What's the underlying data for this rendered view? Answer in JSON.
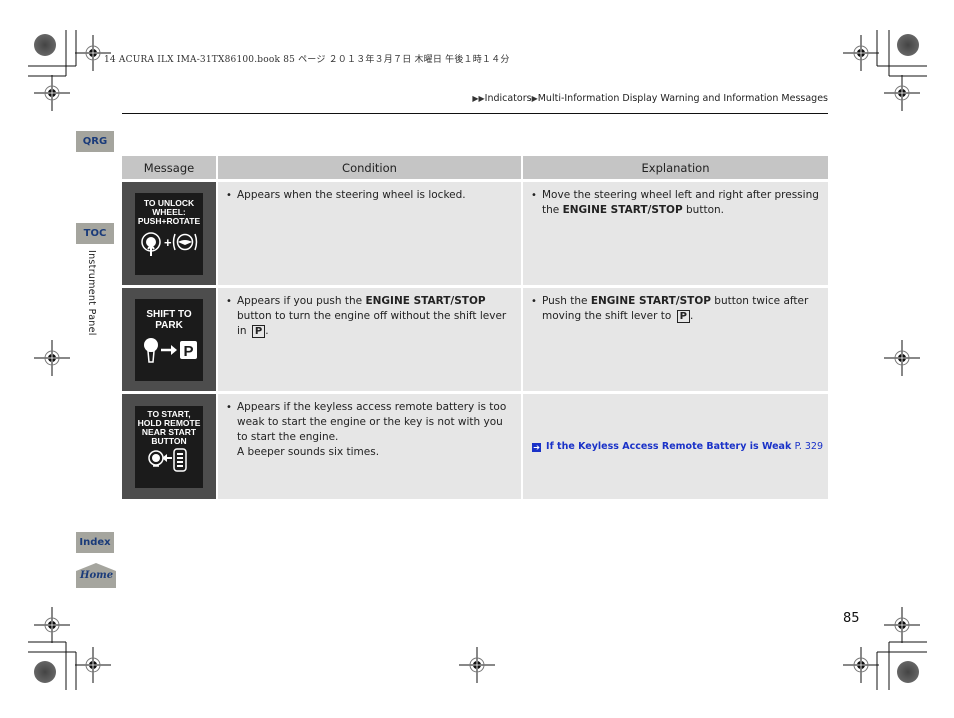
{
  "print_header": "14 ACURA ILX IMA-31TX86100.book  85 ページ  ２０１３年３月７日  木曜日  午後１時１４分",
  "breadcrumb": {
    "prefix_icon": "double-triangle-right-icon",
    "items": [
      "Indicators",
      "Multi-Information Display Warning and Information Messages"
    ],
    "separator_icon": "triangle-right-icon"
  },
  "nav": {
    "qrg": "QRG",
    "toc": "TOC",
    "section_label": "Instrument Panel",
    "index": "Index",
    "home": "Home"
  },
  "table": {
    "headers": [
      "Message",
      "Condition",
      "Explanation"
    ],
    "rows": [
      {
        "message_display": [
          "TO UNLOCK",
          "WHEEL:",
          "PUSH+ROTATE"
        ],
        "message_icon": "push-button-plus-steering-wheel-icon",
        "condition": {
          "text": "Appears when the steering wheel is locked."
        },
        "explanation": {
          "pre": "Move the steering wheel left and right after pressing the ",
          "bold": "ENGINE START/STOP",
          "post": " button."
        }
      },
      {
        "message_display": [
          "SHIFT TO",
          "PARK"
        ],
        "message_icon": "shift-lever-to-park-icon",
        "condition": {
          "pre": "Appears if you push the ",
          "bold": "ENGINE START/STOP",
          "post": " button to turn the engine off without the shift lever in ",
          "box": "P",
          "end": "."
        },
        "explanation": {
          "pre": "Push the ",
          "bold": "ENGINE START/STOP",
          "post": " button twice after moving the shift lever to ",
          "box": "P",
          "end": "."
        }
      },
      {
        "message_display": [
          "TO START,",
          "HOLD REMOTE",
          "NEAR START",
          "BUTTON"
        ],
        "message_icon": "remote-to-start-button-icon",
        "condition": {
          "text": "Appears if the keyless access remote battery is too weak to start the engine or the key is not with you to start the engine.",
          "note": "A beeper sounds six times."
        },
        "explanation": {
          "link_icon": "reference-arrow-icon",
          "link_text": "If the Keyless Access Remote Battery is Weak",
          "page_ref": "P. 329"
        }
      }
    ]
  },
  "page_number": "85"
}
